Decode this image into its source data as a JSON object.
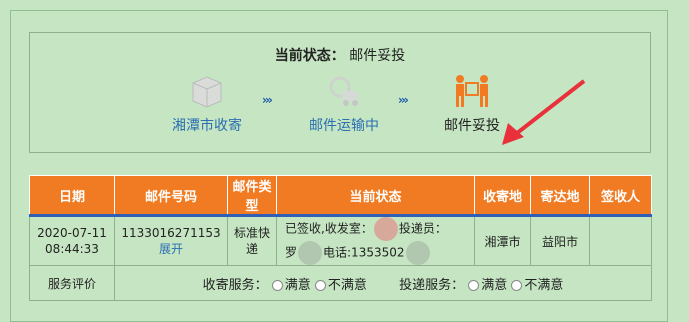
{
  "status": {
    "title_label": "当前状态：",
    "title_value": "邮件妥投"
  },
  "steps": [
    {
      "label": "湘潭市收寄",
      "icon": "box-icon",
      "state": "done"
    },
    {
      "label": "邮件运输中",
      "icon": "truck-icon",
      "state": "done"
    },
    {
      "label": "邮件妥投",
      "icon": "delivery-icon",
      "state": "current"
    }
  ],
  "arrows": [
    "›››",
    "›››"
  ],
  "table": {
    "headers": [
      "日期",
      "邮件号码",
      "邮件类型",
      "当前状态",
      "收寄地",
      "寄达地",
      "签收人"
    ],
    "row": {
      "date": "2020-07-11 08:44:33",
      "number": "1133016271153",
      "expand": "展开",
      "type": "标准快递",
      "status_line1a": "已签收,收发室：",
      "status_line1b": "投递员：",
      "status_line2a": "罗",
      "status_line2b": "电话:1353502",
      "origin": "湘潭市",
      "destination": "益阳市",
      "signer": ""
    },
    "eval": {
      "label": "服务评价",
      "collect_label": "收寄服务：",
      "deliver_label": "投递服务：",
      "satisfied": "满意",
      "unsatisfied": "不满意"
    }
  },
  "colors": {
    "background": "#c6e6c3",
    "header": "#f07b22",
    "link": "#2a6fb0",
    "arrow": "#1c5aa8",
    "pointer_arrow": "#e8313a"
  }
}
